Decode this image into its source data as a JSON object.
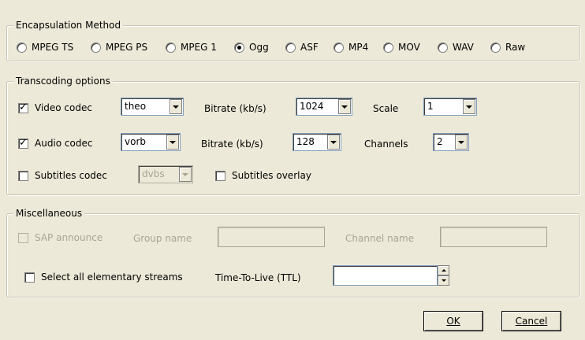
{
  "encapsulation": {
    "legend": "Encapsulation Method",
    "options": [
      {
        "label": "MPEG TS",
        "selected": false
      },
      {
        "label": "MPEG PS",
        "selected": false
      },
      {
        "label": "MPEG 1",
        "selected": false
      },
      {
        "label": "Ogg",
        "selected": true
      },
      {
        "label": "ASF",
        "selected": false
      },
      {
        "label": "MP4",
        "selected": false
      },
      {
        "label": "MOV",
        "selected": false
      },
      {
        "label": "WAV",
        "selected": false
      },
      {
        "label": "Raw",
        "selected": false
      }
    ]
  },
  "transcoding": {
    "legend": "Transcoding options",
    "video_codec_label": "Video codec",
    "video_codec_checked": true,
    "video_codec_value": "theo",
    "video_bitrate_label": "Bitrate (kb/s)",
    "video_bitrate_value": "1024",
    "scale_label": "Scale",
    "scale_value": "1",
    "audio_codec_label": "Audio codec",
    "audio_codec_checked": true,
    "audio_codec_value": "vorb",
    "audio_bitrate_label": "Bitrate (kb/s)",
    "audio_bitrate_value": "128",
    "channels_label": "Channels",
    "channels_value": "2",
    "subtitles_codec_label": "Subtitles codec",
    "subtitles_codec_checked": false,
    "subtitles_codec_value": "dvbs",
    "subtitles_overlay_label": "Subtitles overlay",
    "subtitles_overlay_checked": false
  },
  "misc": {
    "legend": "Miscellaneous",
    "sap_label": "SAP announce",
    "group_name_label": "Group name",
    "group_name_value": "",
    "channel_name_label": "Channel name",
    "channel_name_value": "",
    "select_all_label": "Select all elementary streams",
    "select_all_checked": false,
    "ttl_label": "Time-To-Live (TTL)",
    "ttl_value": ""
  },
  "buttons": {
    "ok": "OK",
    "cancel": "Cancel"
  }
}
